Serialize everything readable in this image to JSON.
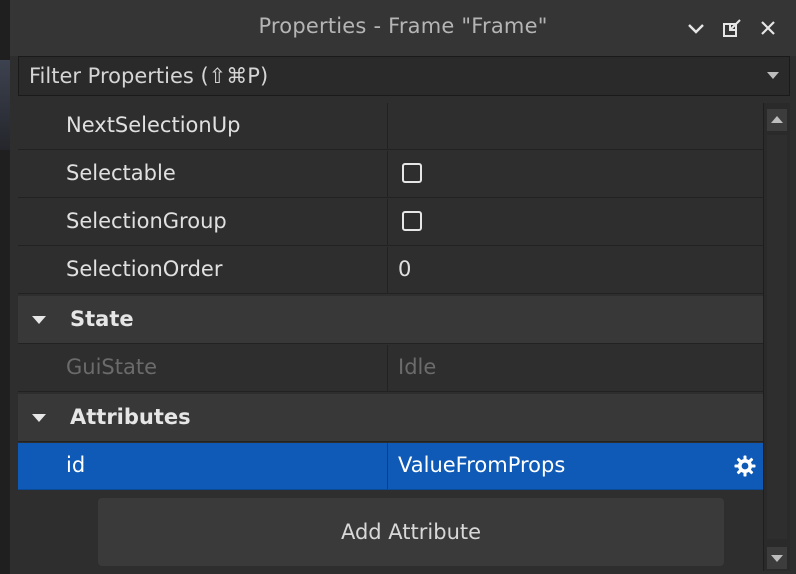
{
  "window": {
    "title": "Properties - Frame \"Frame\""
  },
  "filter": {
    "placeholder": "Filter Properties (⇧⌘P)"
  },
  "properties": {
    "rows": [
      {
        "name": "NextSelectionUp",
        "value": ""
      },
      {
        "name": "Selectable",
        "type": "checkbox",
        "checked": false
      },
      {
        "name": "SelectionGroup",
        "type": "checkbox",
        "checked": false
      },
      {
        "name": "SelectionOrder",
        "value": "0"
      }
    ],
    "state_group": {
      "label": "State",
      "rows": [
        {
          "name": "GuiState",
          "value": "Idle",
          "disabled": true
        }
      ]
    },
    "attributes_group": {
      "label": "Attributes",
      "rows": [
        {
          "name": "id",
          "value": "ValueFromProps",
          "selected": true
        }
      ]
    },
    "add_attribute_label": "Add Attribute"
  },
  "colors": {
    "selection": "#0e5ab6",
    "panel": "#2e2e2e",
    "group_header": "#383838"
  }
}
